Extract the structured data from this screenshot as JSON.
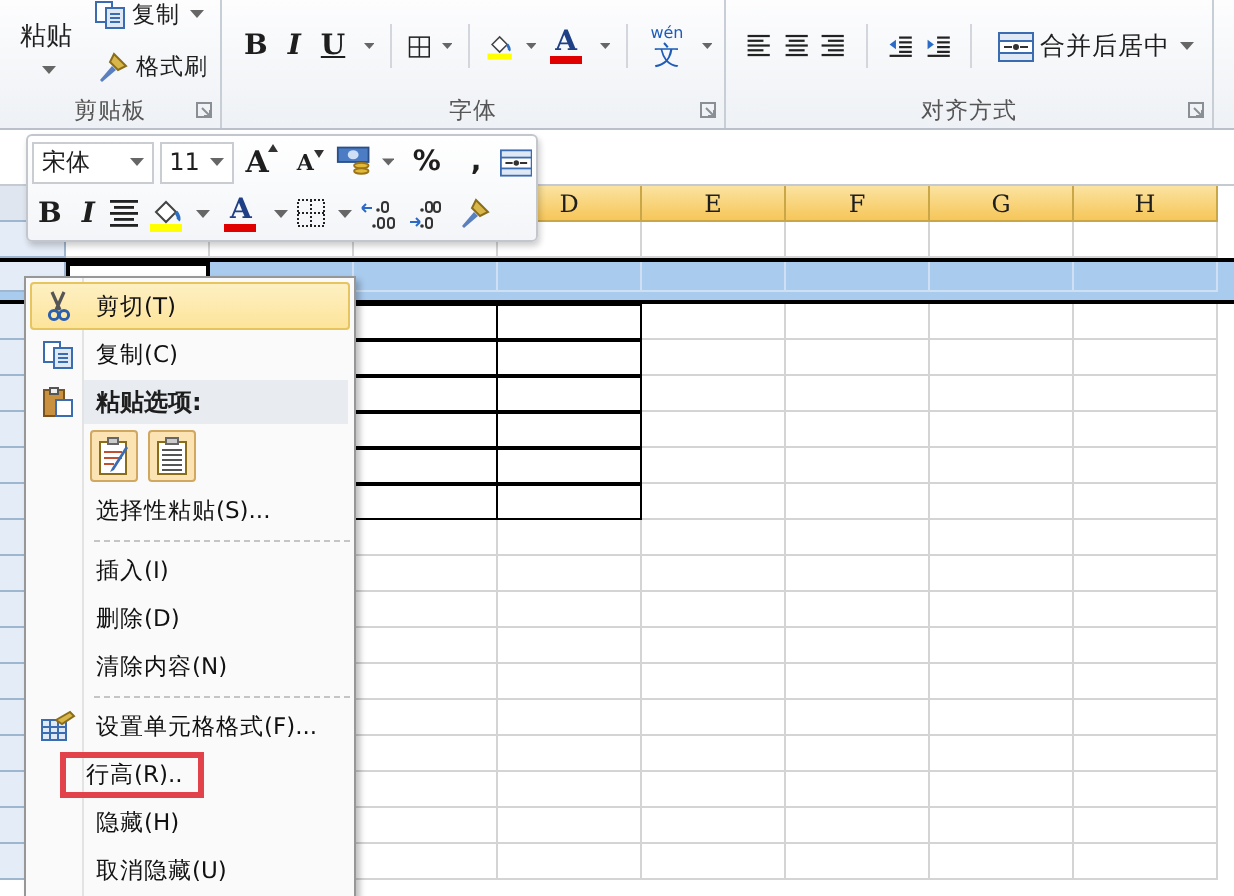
{
  "ribbon": {
    "groups": [
      {
        "kind": "clipboard",
        "label": "剪贴板",
        "paste": "粘贴",
        "copy": "复制",
        "format_painter": "格式刷"
      },
      {
        "kind": "font",
        "label": "字体",
        "bold": "B",
        "italic": "I",
        "underline": "U",
        "font_color": "A",
        "phonetic_top": "wén",
        "phonetic": "文"
      },
      {
        "kind": "alignment",
        "label": "对齐方式",
        "merge": "合并后居中"
      }
    ]
  },
  "mini_toolbar": {
    "font": "宋体",
    "size": "11",
    "grow": "A",
    "shrink": "A",
    "percent": "%",
    "comma": ",",
    "bold": "B",
    "italic": "I",
    "font_color": "A"
  },
  "columns": [
    "D",
    "E",
    "F",
    "G",
    "H"
  ],
  "context_menu": {
    "items": [
      {
        "kind": "cut",
        "label": "剪切(T)",
        "selected": true,
        "highlighted": false
      },
      {
        "kind": "copy",
        "label": "复制(C)",
        "selected": false,
        "highlighted": false
      },
      {
        "kind": "paste_header",
        "label": "粘贴选项:"
      },
      {
        "kind": "paste_icons"
      },
      {
        "kind": "command",
        "label": "选择性粘贴(S)...",
        "selected": false,
        "highlighted": false
      },
      {
        "kind": "separator"
      },
      {
        "kind": "command",
        "label": "插入(I)",
        "selected": false,
        "highlighted": false
      },
      {
        "kind": "command",
        "label": "删除(D)",
        "selected": false,
        "highlighted": false
      },
      {
        "kind": "command",
        "label": "清除内容(N)",
        "selected": false,
        "highlighted": false
      },
      {
        "kind": "separator"
      },
      {
        "kind": "format",
        "label": "设置单元格格式(F)...",
        "selected": false,
        "highlighted": false
      },
      {
        "kind": "command",
        "label": "行高(R)..",
        "selected": false,
        "highlighted": true
      },
      {
        "kind": "command",
        "label": "隐藏(H)",
        "selected": false,
        "highlighted": false
      },
      {
        "kind": "command",
        "label": "取消隐藏(U)",
        "selected": false,
        "highlighted": false
      }
    ]
  }
}
